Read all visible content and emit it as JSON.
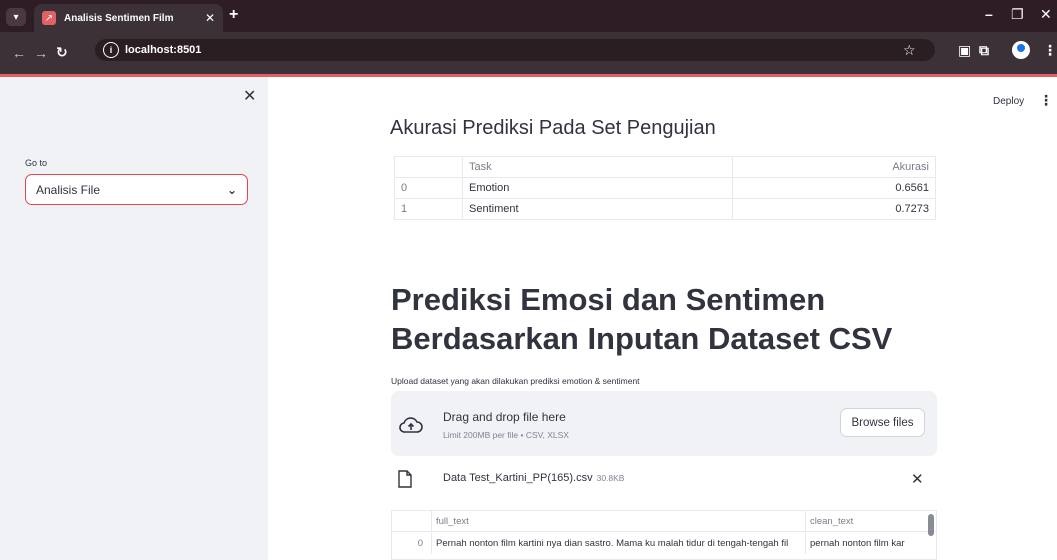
{
  "browser": {
    "tab_title": "Analisis Sentimen Film",
    "url": "localhost:8501",
    "new_tab": "+",
    "tab_close": "✕"
  },
  "sidebar": {
    "close": "✕",
    "goto_label": "Go to",
    "select_value": "Analisis File"
  },
  "header": {
    "deploy": "Deploy",
    "menu": "⋮"
  },
  "accuracy": {
    "title": "Akurasi Prediksi Pada Set Pengujian",
    "columns": [
      "",
      "Task",
      "Akurasi"
    ],
    "rows": [
      {
        "index": "0",
        "task": "Emotion",
        "akurasi": "0.6561"
      },
      {
        "index": "1",
        "task": "Sentiment",
        "akurasi": "0.7273"
      }
    ]
  },
  "prediction": {
    "title": "Prediksi Emosi dan Sentimen Berdasarkan Inputan Dataset CSV",
    "upload_label": "Upload dataset yang akan dilakukan prediksi emotion & sentiment",
    "dropzone_main": "Drag and drop file here",
    "dropzone_sub": "Limit 200MB per file • CSV, XLSX",
    "browse_label": "Browse files",
    "file_name": "Data Test_Kartini_PP(165).csv",
    "file_size": "30.8KB",
    "file_remove": "✕"
  },
  "dataframe": {
    "columns": [
      "",
      "full_text",
      "clean_text"
    ],
    "rows": [
      {
        "index": "0",
        "full_text": "Pernah nonton film kartini nya dian sastro. Mama ku malah tidur di tengah-tengah fil",
        "clean_text": "pernah nonton film kar"
      }
    ]
  },
  "colors": {
    "accent": "#e06066",
    "sidebar_bg": "#f0f2f6",
    "chrome_dark": "#2e1d24"
  }
}
